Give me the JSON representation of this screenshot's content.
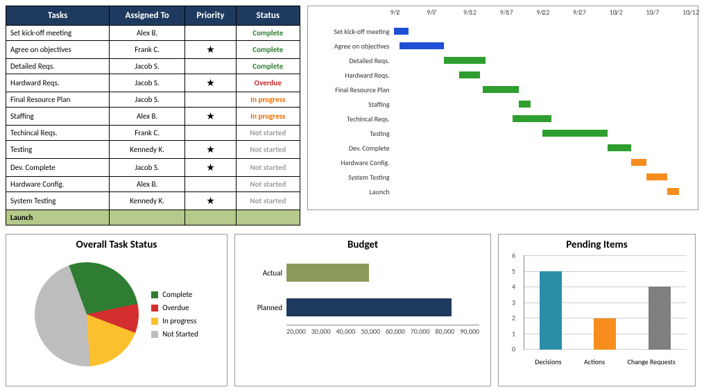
{
  "table": {
    "headers": [
      "Tasks",
      "Assigned To",
      "Priority",
      "Status"
    ],
    "rows": [
      {
        "task": "Set kick-off meeting",
        "assigned": "Alex B.",
        "priority": false,
        "status": "Complete",
        "status_class": "status-complete"
      },
      {
        "task": "Agree on objectives",
        "assigned": "Frank C.",
        "priority": true,
        "status": "Complete",
        "status_class": "status-complete"
      },
      {
        "task": "Detailed Reqs.",
        "assigned": "Jacob S.",
        "priority": false,
        "status": "Complete",
        "status_class": "status-complete"
      },
      {
        "task": "Hardward Reqs.",
        "assigned": "Jacob S.",
        "priority": true,
        "status": "Overdue",
        "status_class": "status-overdue"
      },
      {
        "task": "Final Resource Plan",
        "assigned": "Jacob S.",
        "priority": false,
        "status": "In progress",
        "status_class": "status-inprogress"
      },
      {
        "task": "Staffing",
        "assigned": "Alex B.",
        "priority": true,
        "status": "In progress",
        "status_class": "status-inprogress"
      },
      {
        "task": "Techincal Reqs.",
        "assigned": "Frank C.",
        "priority": false,
        "status": "Not started",
        "status_class": "status-notstarted"
      },
      {
        "task": "Testing",
        "assigned": "Kennedy K.",
        "priority": true,
        "status": "Not started",
        "status_class": "status-notstarted"
      },
      {
        "task": "Dev. Complete",
        "assigned": "Jacob S.",
        "priority": true,
        "status": "Not started",
        "status_class": "status-notstarted"
      },
      {
        "task": "Hardware Config.",
        "assigned": "Alex B.",
        "priority": false,
        "status": "Not started",
        "status_class": "status-notstarted"
      },
      {
        "task": "System Testing",
        "assigned": "Kennedy K.",
        "priority": true,
        "status": "Not started",
        "status_class": "status-notstarted"
      }
    ],
    "launch_label": "Launch"
  },
  "gantt": {
    "axis": [
      "9/2",
      "9/7",
      "9/12",
      "9/17",
      "9/22",
      "9/27",
      "10/2",
      "10/7",
      "10/12"
    ],
    "rows": [
      {
        "label": "Set kick-off meeting",
        "color": "bar-blue",
        "start": 0,
        "width": 5
      },
      {
        "label": "Agree on objectives",
        "color": "bar-blue",
        "start": 2,
        "width": 15
      },
      {
        "label": "Detailed Reqs.",
        "color": "bar-green",
        "start": 17,
        "width": 14
      },
      {
        "label": "Hardward Reqs.",
        "color": "bar-green",
        "start": 22,
        "width": 7
      },
      {
        "label": "Final Resource Plan",
        "color": "bar-green",
        "start": 30,
        "width": 12
      },
      {
        "label": "Staffing",
        "color": "bar-green",
        "start": 42,
        "width": 4
      },
      {
        "label": "Techincal Reqs.",
        "color": "bar-green",
        "start": 40,
        "width": 13
      },
      {
        "label": "Testing",
        "color": "bar-green",
        "start": 50,
        "width": 22
      },
      {
        "label": "Dev. Complete",
        "color": "bar-green",
        "start": 72,
        "width": 8
      },
      {
        "label": "Hardware Config.",
        "color": "bar-orange",
        "start": 80,
        "width": 5
      },
      {
        "label": "System Testing",
        "color": "bar-orange",
        "start": 85,
        "width": 7
      },
      {
        "label": "Launch",
        "color": "bar-orange",
        "start": 92,
        "width": 4
      }
    ]
  },
  "pie": {
    "title": "Overall Task Status",
    "legend": [
      {
        "label": "Complete",
        "color": "#2e7d32"
      },
      {
        "label": "Overdue",
        "color": "#d32f2f"
      },
      {
        "label": "In progress",
        "color": "#fbc02d"
      },
      {
        "label": "Not Started",
        "color": "#bdbdbd"
      }
    ]
  },
  "budget": {
    "title": "Budget",
    "rows": [
      {
        "label": "Actual",
        "value": 50000,
        "color": "#8a9a5b"
      },
      {
        "label": "Planned",
        "value": 80000,
        "color": "#1f3a5f"
      }
    ],
    "axis": [
      "20,000",
      "30,000",
      "40,000",
      "50,000",
      "60,000",
      "70,000",
      "80,000",
      "90,000"
    ]
  },
  "pending": {
    "title": "Pending Items",
    "ymax": 6,
    "bars": [
      {
        "label": "Decisions",
        "value": 5,
        "color": "#2a8ea8"
      },
      {
        "label": "Actions",
        "value": 2,
        "color": "#f68d1e"
      },
      {
        "label": "Change Requests",
        "value": 4,
        "color": "#7f7f7f"
      }
    ]
  },
  "chart_data": [
    {
      "type": "gantt",
      "title": "",
      "x_axis_dates": [
        "9/2",
        "9/7",
        "9/12",
        "9/17",
        "9/22",
        "9/27",
        "10/2",
        "10/7",
        "10/12"
      ],
      "tasks": [
        {
          "name": "Set kick-off meeting",
          "start": "9/2",
          "end": "9/4",
          "group": "complete"
        },
        {
          "name": "Agree on objectives",
          "start": "9/3",
          "end": "9/9",
          "group": "complete"
        },
        {
          "name": "Detailed Reqs.",
          "start": "9/9",
          "end": "9/14",
          "group": "active"
        },
        {
          "name": "Hardward Reqs.",
          "start": "9/11",
          "end": "9/14",
          "group": "active"
        },
        {
          "name": "Final Resource Plan",
          "start": "9/14",
          "end": "9/19",
          "group": "active"
        },
        {
          "name": "Staffing",
          "start": "9/19",
          "end": "9/20",
          "group": "active"
        },
        {
          "name": "Techincal Reqs.",
          "start": "9/18",
          "end": "9/23",
          "group": "active"
        },
        {
          "name": "Testing",
          "start": "9/22",
          "end": "10/1",
          "group": "active"
        },
        {
          "name": "Dev. Complete",
          "start": "10/1",
          "end": "10/4",
          "group": "active"
        },
        {
          "name": "Hardware Config.",
          "start": "10/4",
          "end": "10/6",
          "group": "future"
        },
        {
          "name": "System Testing",
          "start": "10/6",
          "end": "10/9",
          "group": "future"
        },
        {
          "name": "Launch",
          "start": "10/9",
          "end": "10/11",
          "group": "future"
        }
      ]
    },
    {
      "type": "pie",
      "title": "Overall Task Status",
      "series": [
        {
          "name": "Complete",
          "value": 3
        },
        {
          "name": "Overdue",
          "value": 1
        },
        {
          "name": "In progress",
          "value": 2
        },
        {
          "name": "Not Started",
          "value": 5
        }
      ]
    },
    {
      "type": "bar",
      "orientation": "horizontal",
      "title": "Budget",
      "categories": [
        "Actual",
        "Planned"
      ],
      "values": [
        50000,
        80000
      ],
      "xlim": [
        20000,
        90000
      ]
    },
    {
      "type": "bar",
      "title": "Pending Items",
      "categories": [
        "Decisions",
        "Actions",
        "Change Requests"
      ],
      "values": [
        5,
        2,
        4
      ],
      "ylim": [
        0,
        6
      ]
    }
  ]
}
